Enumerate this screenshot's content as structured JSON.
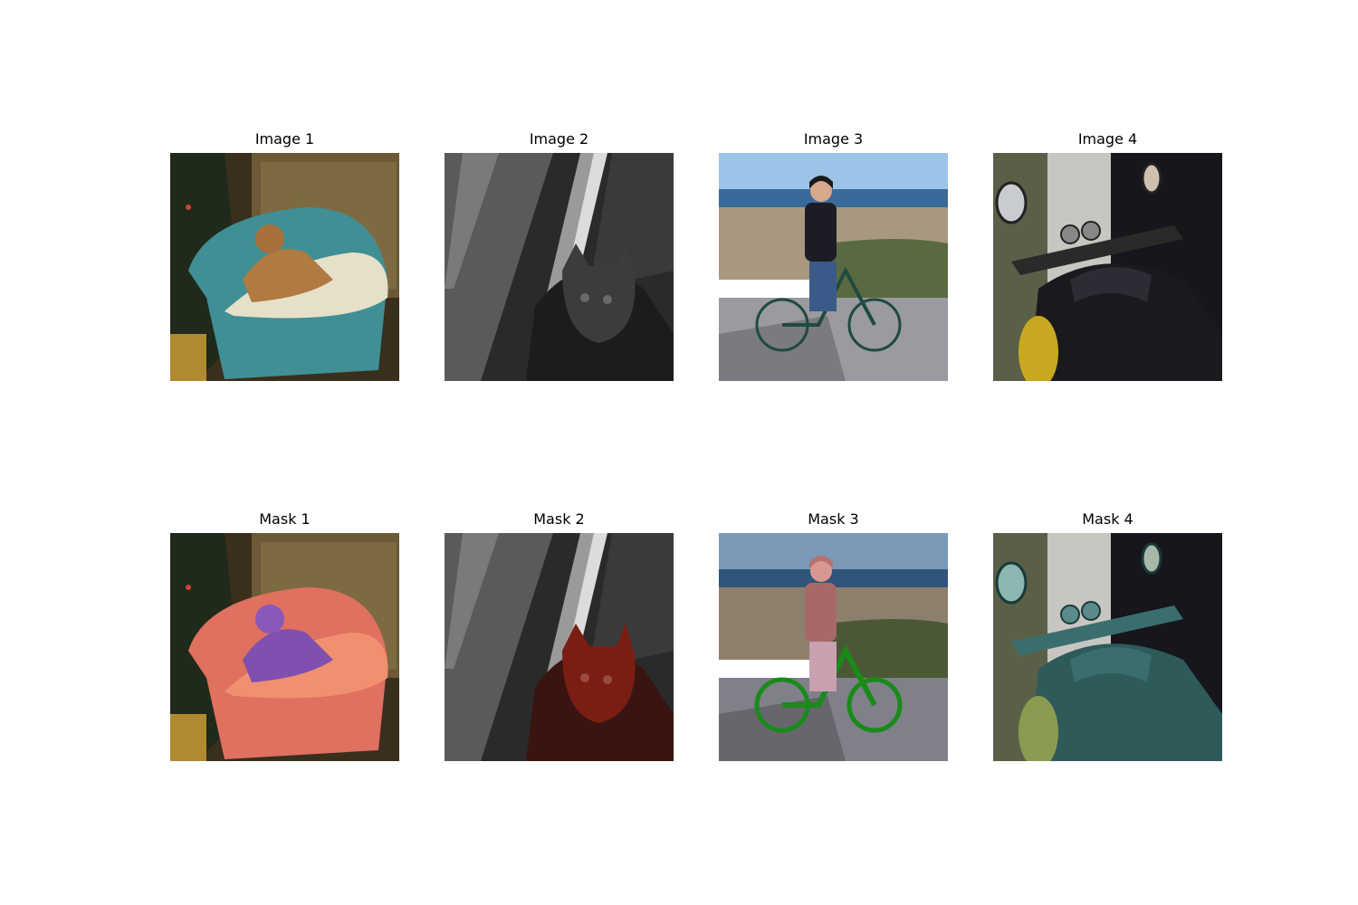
{
  "grid": {
    "row1": [
      {
        "title": "Image 1",
        "subject": "dog-on-armchair"
      },
      {
        "title": "Image 2",
        "subject": "cat-grayscale"
      },
      {
        "title": "Image 3",
        "subject": "woman-on-bicycle-at-beach"
      },
      {
        "title": "Image 4",
        "subject": "motorcycle-front"
      }
    ],
    "row2": [
      {
        "title": "Mask 1",
        "subject": "dog-and-chair-mask-overlay"
      },
      {
        "title": "Mask 2",
        "subject": "cat-mask-overlay"
      },
      {
        "title": "Mask 3",
        "subject": "person-and-bicycle-mask-overlay"
      },
      {
        "title": "Mask 4",
        "subject": "motorcycle-mask-overlay"
      }
    ]
  },
  "overlay_colors": {
    "chair": "#e07060",
    "dog": "#8050b0",
    "cat": "#7a1e14",
    "person": "#c08080",
    "bicycle": "#1a8a1a",
    "motorcycle": "#3a6e6e"
  }
}
